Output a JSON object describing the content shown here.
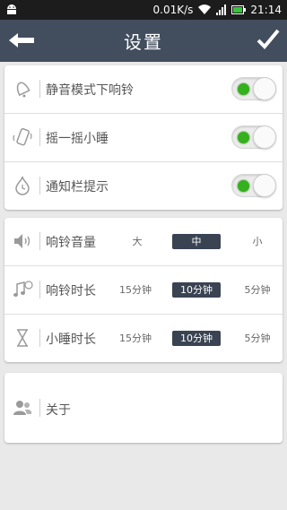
{
  "status": {
    "speed": "0.01K/s",
    "time": "21:14"
  },
  "header": {
    "title": "设置"
  },
  "toggles": [
    {
      "label": "静音模式下响铃",
      "on": true,
      "icon": "bell-icon"
    },
    {
      "label": "摇一摇小睡",
      "on": true,
      "icon": "shake-phone-icon"
    },
    {
      "label": "通知栏提示",
      "on": true,
      "icon": "clock-drop-icon"
    }
  ],
  "volume": {
    "label": "响铃音量",
    "options": [
      "大",
      "中",
      "小"
    ],
    "selected": "中"
  },
  "ring_duration": {
    "label": "响铃时长",
    "options": [
      "15分钟",
      "10分钟",
      "5分钟"
    ],
    "selected": "10分钟"
  },
  "snooze_duration": {
    "label": "小睡时长",
    "options": [
      "15分钟",
      "10分钟",
      "5分钟"
    ],
    "selected": "10分钟"
  },
  "about": {
    "label": "关于"
  },
  "colors": {
    "titlebar": "#424d5d",
    "selected": "#3a4352",
    "toggle_on": "#35b01e"
  }
}
